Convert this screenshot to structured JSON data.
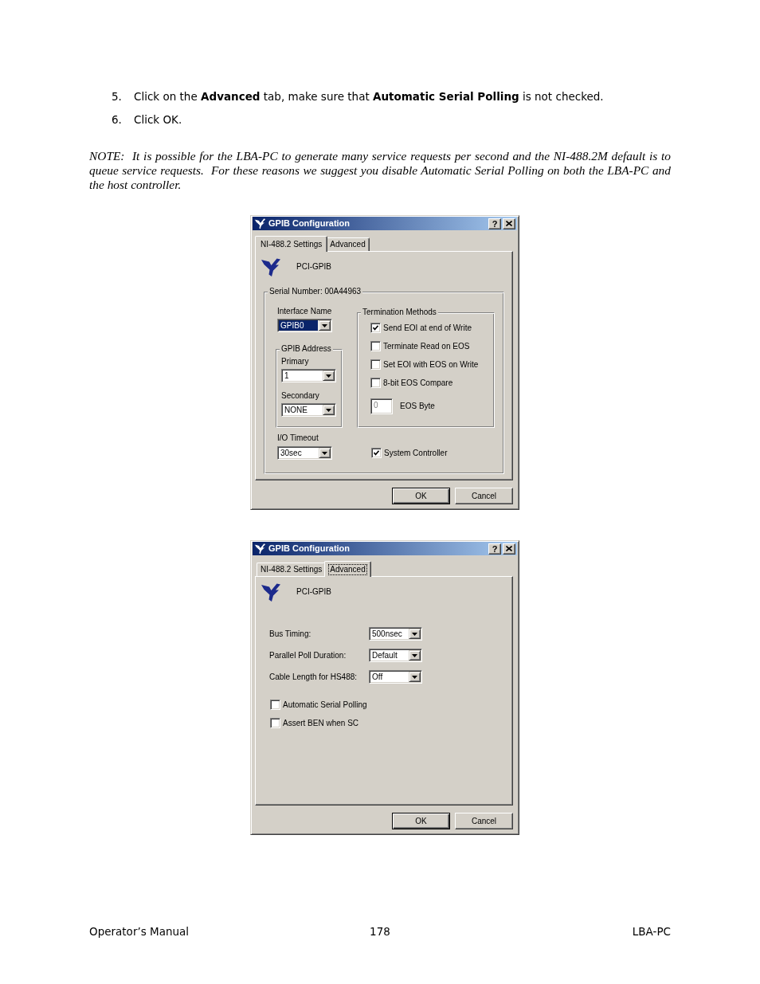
{
  "steps": [
    {
      "number": "5.",
      "text": "Click on the **Advanced** tab, make sure that **Automatic Serial Polling** is not checked."
    },
    {
      "number": "6.",
      "text": "Click OK."
    }
  ],
  "note": "NOTE:  It is possible for the LBA-PC to generate many service requests per second and the NI-488.2M default is to queue service requests.  For these reasons we suggest you disable Automatic Serial Polling on both the LBA-PC and the host controller.",
  "dialogs": [
    {
      "title": "GPIB Configuration",
      "help_button": "?",
      "tabs": [
        {
          "label": "NI-488.2 Settings",
          "selected": true,
          "focused": false
        },
        {
          "label": "Advanced",
          "selected": false,
          "focused": false
        }
      ],
      "page": {
        "kind": "settings",
        "device": "PCI-GPIB",
        "serial_group": "Serial Number: 00A44963",
        "interface_name": {
          "label": "Interface Name",
          "value": "GPIB0",
          "focused": true
        },
        "address_group": {
          "title": "GPIB Address",
          "fields": [
            {
              "label": "Primary",
              "value": "1",
              "focused": false
            },
            {
              "label": "Secondary",
              "value": "NONE",
              "focused": false
            }
          ]
        },
        "io_timeout": {
          "label": "I/O Timeout",
          "value": "30sec",
          "focused": false
        },
        "termination": {
          "title": "Termination Methods",
          "options": [
            {
              "label": "Send EOI at end of Write",
              "checked": true
            },
            {
              "label": "Terminate Read on EOS",
              "checked": false
            },
            {
              "label": "Set EOI with EOS on Write",
              "checked": false
            },
            {
              "label": "8-bit EOS Compare",
              "checked": false
            }
          ],
          "eos_byte": {
            "label": "EOS Byte",
            "value": "0",
            "disabled": true
          }
        },
        "system_controller": {
          "label": "System Controller",
          "checked": true
        }
      },
      "buttons": [
        {
          "label": "OK",
          "default": true
        },
        {
          "label": "Cancel",
          "default": false
        }
      ]
    },
    {
      "title": "GPIB Configuration",
      "help_button": "?",
      "tabs": [
        {
          "label": "NI-488.2 Settings",
          "selected": false,
          "focused": false
        },
        {
          "label": "Advanced",
          "selected": true,
          "focused": true
        }
      ],
      "page": {
        "kind": "advanced",
        "device": "PCI-GPIB",
        "fields": [
          {
            "label": "Bus Timing:",
            "value": "500nsec",
            "focused": false
          },
          {
            "label": "Parallel Poll Duration:",
            "value": "Default",
            "focused": false
          },
          {
            "label": "Cable Length for HS488:",
            "value": "Off",
            "focused": false
          }
        ],
        "options": [
          {
            "label": "Automatic Serial Polling",
            "checked": false
          },
          {
            "label": "Assert BEN when SC",
            "checked": false
          }
        ]
      },
      "buttons": [
        {
          "label": "OK",
          "default": true
        },
        {
          "label": "Cancel",
          "default": false
        }
      ]
    }
  ],
  "footer": {
    "left": "Operator’s Manual",
    "center": "178",
    "right": "LBA-PC"
  }
}
